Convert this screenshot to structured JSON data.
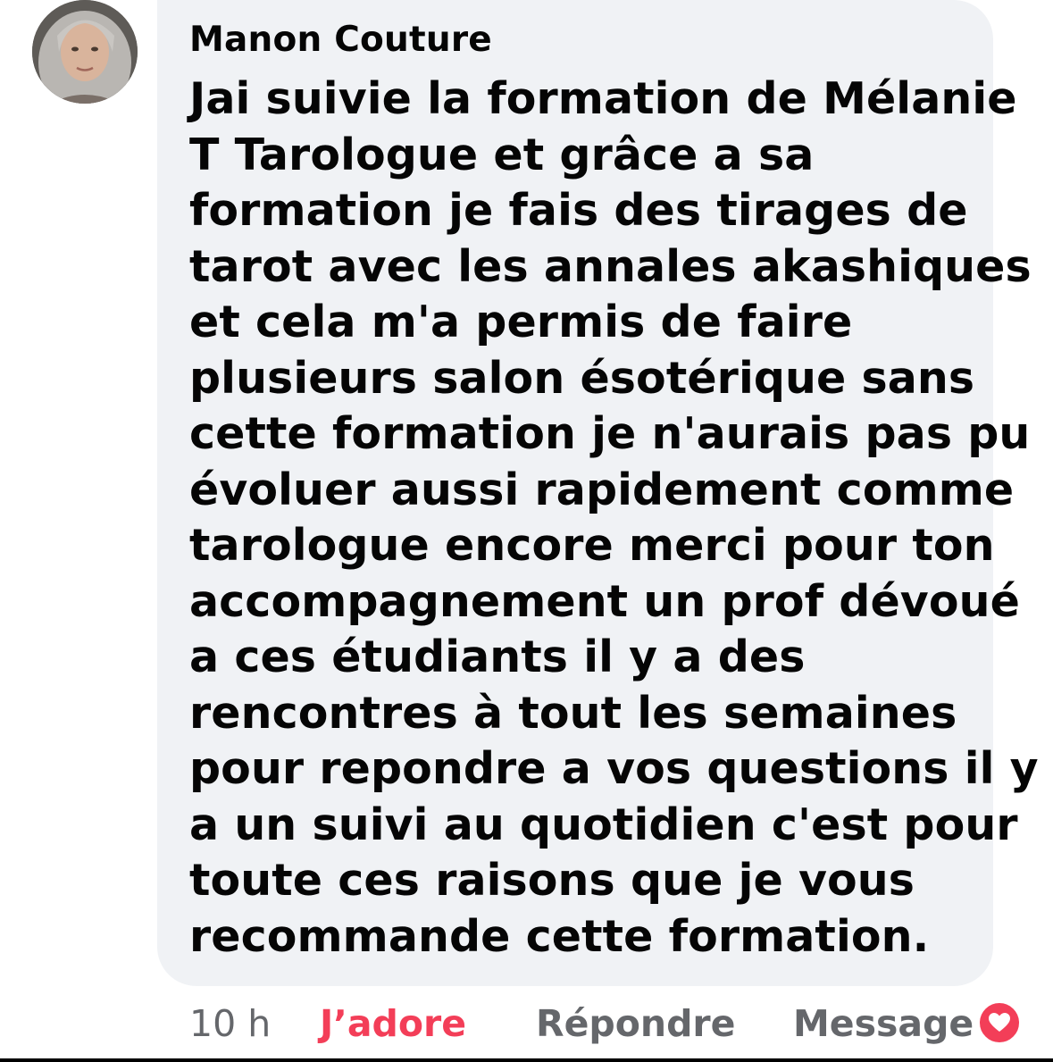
{
  "comment": {
    "author": "Manon Couture",
    "text_lines": [
      "Jai suivie la formation de Mélanie",
      "T Tarologue et grâce a sa",
      "formation je fais des tirages de",
      "tarot avec les annales akashiques",
      "et cela m'a permis de faire",
      "plusieurs salon ésotérique sans",
      "cette formation je n'aurais pas pu",
      "évoluer aussi rapidement comme",
      "tarologue encore merci pour ton",
      "accompagnement un prof dévoué",
      "a ces étudiants il y a des",
      "rencontres à tout les semaines",
      "pour repondre a vos questions il y",
      "a un suivi au quotidien c'est pour",
      "toute ces raisons que je vous",
      "recommande cette formation."
    ]
  },
  "actions": {
    "time": "10 h",
    "love_label": "J’adore",
    "reply_label": "Répondre",
    "message_label": "Message"
  },
  "icons": {
    "avatar": "profile-photo",
    "reaction": "heart-icon"
  },
  "colors": {
    "bubble_bg": "#f0f2f5",
    "text": "#050505",
    "secondary": "#65676b",
    "love": "#f33e58"
  }
}
